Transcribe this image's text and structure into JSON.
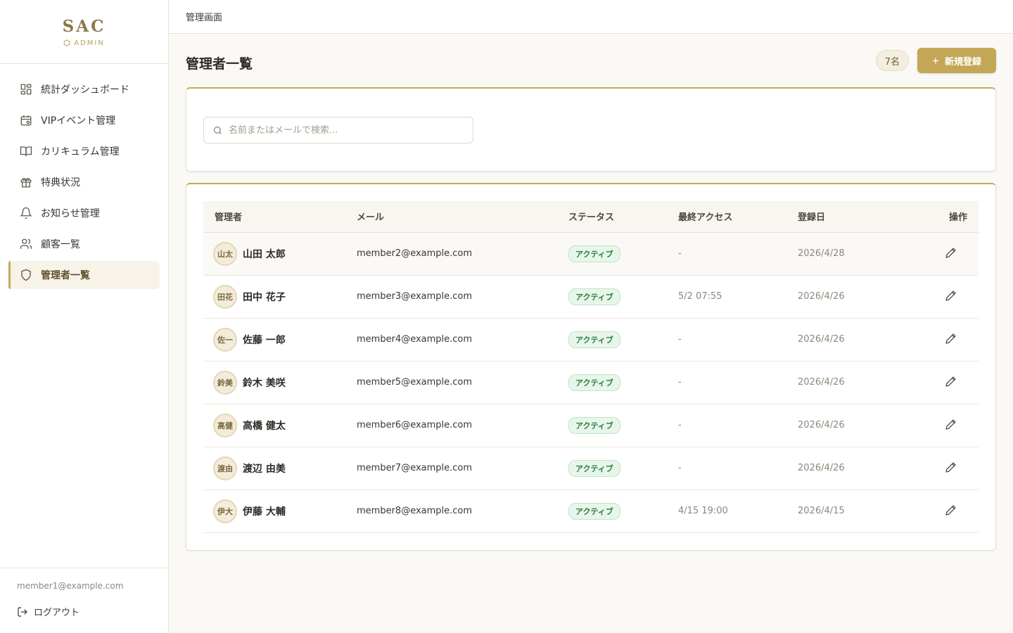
{
  "brand": {
    "name": "SAC",
    "sub": "ADMIN"
  },
  "nav": [
    {
      "label": "統計ダッシュボード",
      "icon": "dashboard-icon",
      "active": false
    },
    {
      "label": "VIPイベント管理",
      "icon": "calendar-icon",
      "active": false
    },
    {
      "label": "カリキュラム管理",
      "icon": "book-icon",
      "active": false
    },
    {
      "label": "特典状況",
      "icon": "gift-icon",
      "active": false
    },
    {
      "label": "お知らせ管理",
      "icon": "bell-icon",
      "active": false
    },
    {
      "label": "顧客一覧",
      "icon": "users-icon",
      "active": false
    },
    {
      "label": "管理者一覧",
      "icon": "shield-icon",
      "active": true
    }
  ],
  "footer": {
    "email": "member1@example.com",
    "logout_label": "ログアウト"
  },
  "topbar": {
    "title": "管理画面"
  },
  "page": {
    "title": "管理者一覧",
    "count": "7名",
    "new_button": "新規登録",
    "new_button_icon": "+"
  },
  "search": {
    "placeholder": "名前またはメールで検索..."
  },
  "table": {
    "headers": {
      "name": "管理者",
      "mail": "メール",
      "status": "ステータス",
      "access": "最終アクセス",
      "registered": "登録日",
      "actions": "操作"
    },
    "rows": [
      {
        "avatar": "山太",
        "name": "山田 太郎",
        "mail": "member2@example.com",
        "status": "アクティブ",
        "access": "-",
        "registered": "2026/4/28"
      },
      {
        "avatar": "田花",
        "name": "田中 花子",
        "mail": "member3@example.com",
        "status": "アクティブ",
        "access": "5/2 07:55",
        "registered": "2026/4/26"
      },
      {
        "avatar": "佐一",
        "name": "佐藤 一郎",
        "mail": "member4@example.com",
        "status": "アクティブ",
        "access": "-",
        "registered": "2026/4/26"
      },
      {
        "avatar": "鈴美",
        "name": "鈴木 美咲",
        "mail": "member5@example.com",
        "status": "アクティブ",
        "access": "-",
        "registered": "2026/4/26"
      },
      {
        "avatar": "高健",
        "name": "高橋 健太",
        "mail": "member6@example.com",
        "status": "アクティブ",
        "access": "-",
        "registered": "2026/4/26"
      },
      {
        "avatar": "渡由",
        "name": "渡辺 由美",
        "mail": "member7@example.com",
        "status": "アクティブ",
        "access": "-",
        "registered": "2026/4/26"
      },
      {
        "avatar": "伊大",
        "name": "伊藤 大輔",
        "mail": "member8@example.com",
        "status": "アクティブ",
        "access": "4/15 19:00",
        "registered": "2026/4/15"
      }
    ]
  },
  "colors": {
    "accent": "#c4a657",
    "brand": "#8a7a4c",
    "status_green": "#2c7a3c",
    "active_nav_bg": "#f7f3e8"
  }
}
